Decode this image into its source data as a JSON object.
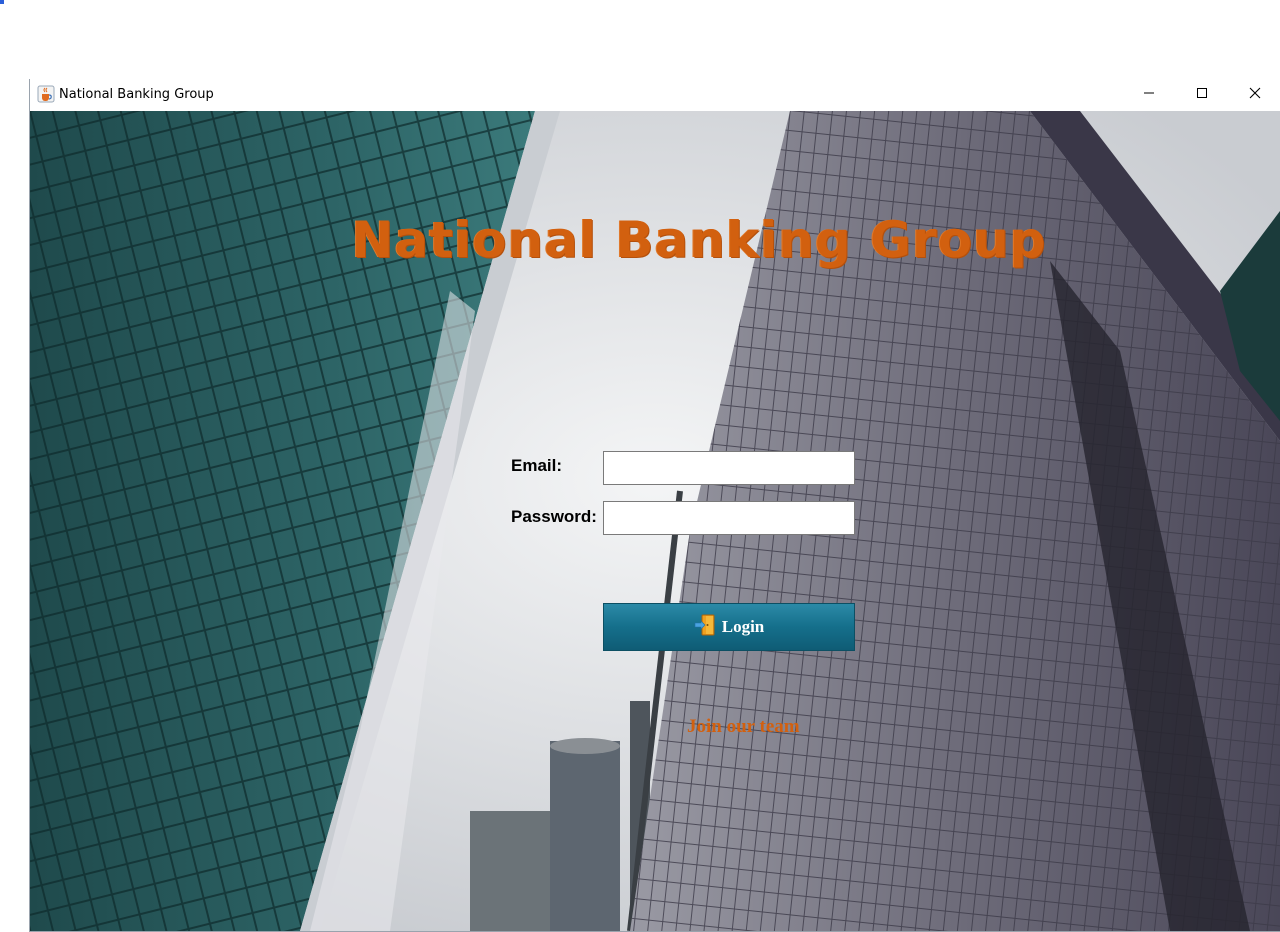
{
  "window": {
    "title": "National Banking Group",
    "icons": {
      "app": "java-cup-icon",
      "minimize": "minimize-icon",
      "maximize": "maximize-icon",
      "close": "close-icon"
    }
  },
  "brand": {
    "title": "National Banking Group",
    "color": "#d2600f"
  },
  "form": {
    "email_label": "Email:",
    "email_value": "",
    "password_label": "Password:",
    "password_value": "",
    "login_label": "Login",
    "login_icon": "door-enter-icon",
    "join_label": "Join our team"
  },
  "colors": {
    "accent": "#d2600f",
    "button": "#156f8b"
  }
}
